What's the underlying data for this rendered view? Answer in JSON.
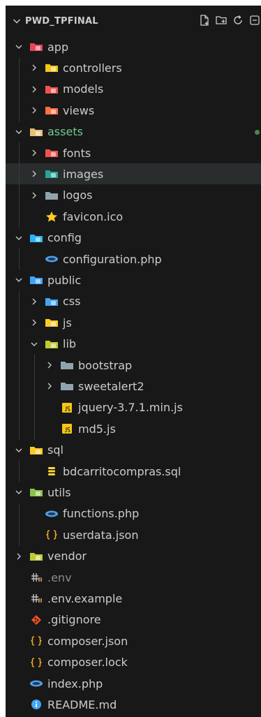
{
  "explorer": {
    "title": "PWD_TPFINAL",
    "actions": [
      "new-file-icon",
      "new-folder-icon",
      "refresh-icon",
      "collapse-all-icon"
    ]
  },
  "colors": {
    "background": "#181818",
    "text": "#cccccc",
    "modified": "#73c991",
    "ignored": "#8c8c8c",
    "hover": "#2a2d2e"
  },
  "tree": [
    {
      "label": "app",
      "depth": 0,
      "kind": "folder",
      "state": "open",
      "icon": "app-folder-icon",
      "color": "#e8475a"
    },
    {
      "label": "controllers",
      "depth": 1,
      "kind": "folder",
      "state": "closed",
      "icon": "controllers-folder-icon",
      "color": "#f5c518"
    },
    {
      "label": "models",
      "depth": 1,
      "kind": "folder",
      "state": "closed",
      "icon": "models-folder-icon",
      "color": "#ef5350"
    },
    {
      "label": "views",
      "depth": 1,
      "kind": "folder",
      "state": "closed",
      "icon": "views-folder-icon",
      "color": "#ff7043"
    },
    {
      "label": "assets",
      "depth": 0,
      "kind": "folder",
      "state": "open",
      "icon": "assets-folder-icon",
      "color": "#e5c07b",
      "modified": true
    },
    {
      "label": "fonts",
      "depth": 1,
      "kind": "folder",
      "state": "closed",
      "icon": "fonts-folder-icon",
      "color": "#ef5350"
    },
    {
      "label": "images",
      "depth": 1,
      "kind": "folder",
      "state": "closed",
      "icon": "images-folder-icon",
      "color": "#26a69a"
    },
    {
      "label": "logos",
      "depth": 1,
      "kind": "folder",
      "state": "closed",
      "icon": "folder-icon",
      "color": "#90a4ae"
    },
    {
      "label": "favicon.ico",
      "depth": 1,
      "kind": "file",
      "icon": "star-icon",
      "color": "#ffca28"
    },
    {
      "label": "config",
      "depth": 0,
      "kind": "folder",
      "state": "open",
      "icon": "config-folder-icon",
      "color": "#29b6f6"
    },
    {
      "label": "configuration.php",
      "depth": 1,
      "kind": "file",
      "icon": "php-icon",
      "color": "#4f9fe6"
    },
    {
      "label": "public",
      "depth": 0,
      "kind": "folder",
      "state": "open",
      "icon": "public-folder-icon",
      "color": "#42a5f5"
    },
    {
      "label": "css",
      "depth": 1,
      "kind": "folder",
      "state": "closed",
      "icon": "css-folder-icon",
      "color": "#42a5f5"
    },
    {
      "label": "js",
      "depth": 1,
      "kind": "folder",
      "state": "closed",
      "icon": "js-folder-icon",
      "color": "#ffca28"
    },
    {
      "label": "lib",
      "depth": 1,
      "kind": "folder",
      "state": "open",
      "icon": "lib-folder-icon",
      "color": "#c0ca33"
    },
    {
      "label": "bootstrap",
      "depth": 2,
      "kind": "folder",
      "state": "closed",
      "icon": "folder-icon",
      "color": "#90a4ae"
    },
    {
      "label": "sweetalert2",
      "depth": 2,
      "kind": "folder",
      "state": "closed",
      "icon": "folder-icon",
      "color": "#90a4ae"
    },
    {
      "label": "jquery-3.7.1.min.js",
      "depth": 2,
      "kind": "file",
      "icon": "js-file-icon",
      "color": "#f5c518"
    },
    {
      "label": "md5.js",
      "depth": 2,
      "kind": "file",
      "icon": "js-file-icon",
      "color": "#f5c518"
    },
    {
      "label": "sql",
      "depth": 0,
      "kind": "folder",
      "state": "open",
      "icon": "sql-folder-icon",
      "color": "#ffca28"
    },
    {
      "label": "bdcarritocompras.sql",
      "depth": 1,
      "kind": "file",
      "icon": "database-icon",
      "color": "#fdd835"
    },
    {
      "label": "utils",
      "depth": 0,
      "kind": "folder",
      "state": "open",
      "icon": "utils-folder-icon",
      "color": "#8bc34a"
    },
    {
      "label": "functions.php",
      "depth": 1,
      "kind": "file",
      "icon": "php-icon",
      "color": "#4f9fe6"
    },
    {
      "label": "userdata.json",
      "depth": 1,
      "kind": "file",
      "icon": "json-icon",
      "color": "#f5a623"
    },
    {
      "label": "vendor",
      "depth": 0,
      "kind": "folder",
      "state": "closed",
      "icon": "vendor-folder-icon",
      "color": "#c0ca33"
    },
    {
      "label": ".env",
      "depth": 0,
      "kind": "file",
      "icon": "env-icon",
      "color": "#c0c0c0",
      "ignored": true
    },
    {
      "label": ".env.example",
      "depth": 0,
      "kind": "file",
      "icon": "env-icon",
      "color": "#c0c0c0"
    },
    {
      "label": ".gitignore",
      "depth": 0,
      "kind": "file",
      "icon": "git-icon",
      "color": "#f4511e"
    },
    {
      "label": "composer.json",
      "depth": 0,
      "kind": "file",
      "icon": "json-icon",
      "color": "#f5a623"
    },
    {
      "label": "composer.lock",
      "depth": 0,
      "kind": "file",
      "icon": "json-icon",
      "color": "#f5a623"
    },
    {
      "label": "index.php",
      "depth": 0,
      "kind": "file",
      "icon": "php-icon",
      "color": "#4f9fe6"
    },
    {
      "label": "README.md",
      "depth": 0,
      "kind": "file",
      "icon": "info-icon",
      "color": "#42a5f5"
    }
  ]
}
